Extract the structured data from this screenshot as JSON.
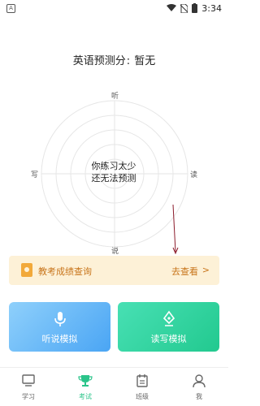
{
  "status_bar": {
    "app_badge": "A",
    "time": "3:34"
  },
  "header": {
    "label": "英语预测分",
    "separator": ":",
    "value": "暂无"
  },
  "radar": {
    "axes": {
      "top": "听",
      "right": "读",
      "bottom": "说",
      "left": "写"
    },
    "empty_message_line1": "你练习太少",
    "empty_message_line2": "还无法预测"
  },
  "score_banner": {
    "label": "教考成绩查询",
    "link": "去查看",
    "chevron": ">"
  },
  "practice_cards": {
    "listen": {
      "label": "听说模拟"
    },
    "write": {
      "label": "读写模拟"
    }
  },
  "tabbar": {
    "tabs": [
      {
        "label": "学习",
        "active": false
      },
      {
        "label": "考试",
        "active": true
      },
      {
        "label": "班级",
        "active": false
      },
      {
        "label": "我",
        "active": false
      }
    ]
  },
  "colors": {
    "accent": "#2bc48a",
    "banner_bg": "#fdf1d7",
    "banner_text": "#c8741a",
    "listen_card": "#4aa5f4",
    "write_card": "#22c98f"
  }
}
